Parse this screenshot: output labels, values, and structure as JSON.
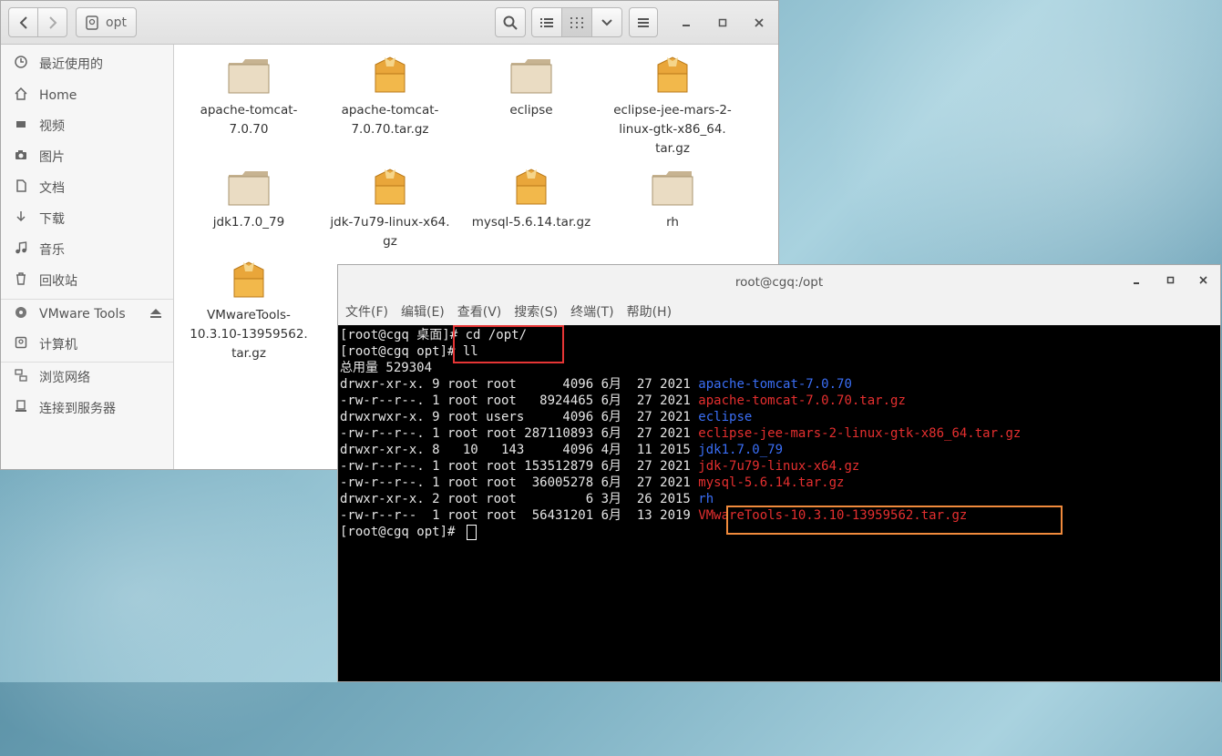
{
  "file_manager": {
    "path_label": "opt",
    "sidebar": {
      "items": [
        {
          "label": "最近使用的",
          "icon": "clock-icon"
        },
        {
          "label": "Home",
          "icon": "home-icon"
        },
        {
          "label": "视频",
          "icon": "video-icon"
        },
        {
          "label": "图片",
          "icon": "camera-icon"
        },
        {
          "label": "文档",
          "icon": "document-icon"
        },
        {
          "label": "下载",
          "icon": "download-icon"
        },
        {
          "label": "音乐",
          "icon": "music-icon"
        },
        {
          "label": "回收站",
          "icon": "trash-icon"
        }
      ],
      "devices": [
        {
          "label": "VMware Tools",
          "icon": "disc-icon"
        },
        {
          "label": "计算机",
          "icon": "computer-icon"
        }
      ],
      "network": [
        {
          "label": "浏览网络",
          "icon": "network-icon"
        },
        {
          "label": "连接到服务器",
          "icon": "server-icon"
        }
      ]
    },
    "files": [
      {
        "line1": "apache-tomcat-",
        "line2": "7.0.70",
        "line3": "",
        "type": "folder"
      },
      {
        "line1": "apache-tomcat-",
        "line2": "7.0.70.tar.gz",
        "line3": "",
        "type": "archive"
      },
      {
        "line1": "eclipse",
        "line2": "",
        "line3": "",
        "type": "folder"
      },
      {
        "line1": "eclipse-jee-mars-2-",
        "line2": "linux-gtk-x86_64.",
        "line3": "tar.gz",
        "type": "archive"
      },
      {
        "line1": "jdk1.7.0_79",
        "line2": "",
        "line3": "",
        "type": "folder"
      },
      {
        "line1": "jdk-7u79-linux-x64.",
        "line2": "gz",
        "line3": "",
        "type": "archive"
      },
      {
        "line1": "mysql-5.6.14.tar.gz",
        "line2": "",
        "line3": "",
        "type": "archive"
      },
      {
        "line1": "rh",
        "line2": "",
        "line3": "",
        "type": "folder"
      },
      {
        "line1": "VMwareTools-",
        "line2": "10.3.10-13959562.",
        "line3": "tar.gz",
        "type": "archive"
      }
    ]
  },
  "terminal": {
    "title": "root@cgq:/opt",
    "menu": [
      "文件(F)",
      "编辑(E)",
      "查看(V)",
      "搜索(S)",
      "终端(T)",
      "帮助(H)"
    ],
    "lines": [
      "[root@cgq 桌面]# cd /opt/",
      "[root@cgq opt]# ll",
      "总用量 529304"
    ],
    "listing": [
      {
        "meta": "drwxr-xr-x. 9 root root      4096 6月  27 2021 ",
        "name": "apache-tomcat-7.0.70",
        "color": "#3a6ef5"
      },
      {
        "meta": "-rw-r--r--. 1 root root   8924465 6月  27 2021 ",
        "name": "apache-tomcat-7.0.70.tar.gz",
        "color": "#e52f2f"
      },
      {
        "meta": "drwxrwxr-x. 9 root users     4096 6月  27 2021 ",
        "name": "eclipse",
        "color": "#3a6ef5"
      },
      {
        "meta": "-rw-r--r--. 1 root root 287110893 6月  27 2021 ",
        "name": "eclipse-jee-mars-2-linux-gtk-x86_64.tar.gz",
        "color": "#e52f2f"
      },
      {
        "meta": "drwxr-xr-x. 8   10   143     4096 4月  11 2015 ",
        "name": "jdk1.7.0_79",
        "color": "#3a6ef5"
      },
      {
        "meta": "-rw-r--r--. 1 root root 153512879 6月  27 2021 ",
        "name": "jdk-7u79-linux-x64.gz",
        "color": "#e52f2f"
      },
      {
        "meta": "-rw-r--r--. 1 root root  36005278 6月  27 2021 ",
        "name": "mysql-5.6.14.tar.gz",
        "color": "#e52f2f"
      },
      {
        "meta": "drwxr-xr-x. 2 root root         6 3月  26 2015 ",
        "name": "rh",
        "color": "#3a6ef5"
      },
      {
        "meta": "-rw-r--r--  1 root root  56431201 6月  13 2019 ",
        "name": "VMwareTools-10.3.10-13959562.tar.gz",
        "color": "#e52f2f"
      }
    ],
    "prompt": "[root@cgq opt]# "
  },
  "colors": {
    "red_highlight": "#e53535",
    "orange_highlight": "#f08a3c",
    "dir_blue": "#3a6ef5",
    "archive_red": "#e52f2f"
  }
}
